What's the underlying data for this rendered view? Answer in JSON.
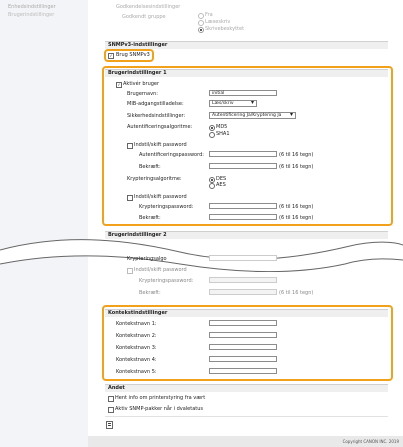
{
  "sidebar": {
    "item1": "Enhedsindstillinger",
    "item2": "Brugerindstillinger"
  },
  "top": {
    "header": "Godkendelsesindstillinger",
    "label": "Godkendt gruppe",
    "options": [
      "Fra",
      "Læseskriv",
      "Skrivebeskyttet"
    ]
  },
  "snmpv3": {
    "section_title": "SNMPv3-indstillinger",
    "use_label": "Brug SNMPv3"
  },
  "user1": {
    "title": "Brugerindstillinger 1",
    "activate": "Aktivér bruger",
    "username_label": "Brugernavn:",
    "username_value": "initial",
    "mib_label": "MIB-adgangstilladelse:",
    "mib_value": "Læs/skriv",
    "security_label": "Sikkerhedsindstillinger:",
    "security_value": "Autentificering Ja/Kryptering Ja",
    "auth_algo_label": "Autentificeringsalgoritme:",
    "auth_algos": [
      "MD5",
      "SHA1"
    ],
    "set_auth_pw": "Indstil/skift password",
    "auth_pw_label": "Autentificeringspassword:",
    "auth_pw_hint": "(6 til 16 tegn)",
    "confirm_label": "Bekræft:",
    "confirm_hint": "(6 til 16 tegn)",
    "enc_algo_label": "Krypteringsalgoritme:",
    "enc_algos": [
      "DES",
      "AES"
    ],
    "set_enc_pw": "Indstil/skift password",
    "enc_pw_label": "Krypteringspassword:",
    "enc_pw_hint": "(6 til 16 tegn)",
    "confirm2_label": "Bekræft:",
    "confirm2_hint": "(6 til 16 tegn)"
  },
  "user2": {
    "title": "Brugerindstillinger 2",
    "enc_label": "Krypteringsalgo",
    "set_pw": "Indstil/skift password",
    "enc_pw_label": "Krypteringspassword:",
    "confirm_label": "Bekræft:",
    "confirm_hint": "(6 til 16 tegn)"
  },
  "context": {
    "title": "Kontekstindstillinger",
    "names": [
      "Kontekstnavn 1:",
      "Kontekstnavn 2:",
      "Kontekstnavn 3:",
      "Kontekstnavn 4:",
      "Kontekstnavn 5:"
    ]
  },
  "other": {
    "title": "Andet",
    "opt1": "Hent info om printerstyring fra vært",
    "opt2": "Aktiv SNMP-pakker når i dvaletatus"
  },
  "footer": {
    "copyright": "Copyright CANON INC. 2019"
  },
  "colors": {
    "highlight": "#f2a21a",
    "section_bg": "#efefef"
  }
}
